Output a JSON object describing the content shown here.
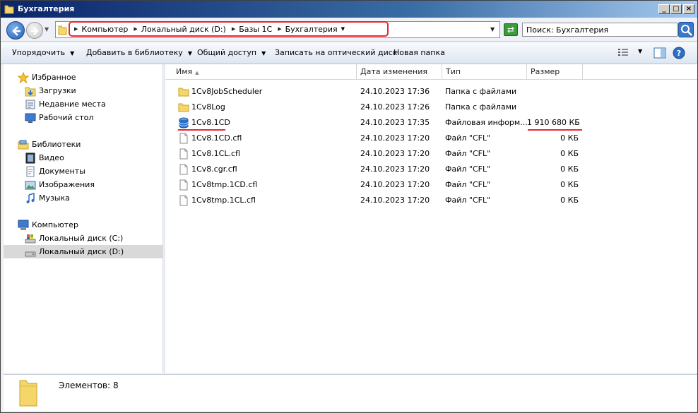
{
  "window": {
    "title": "Бухгалтерия",
    "controls": [
      "_",
      "□",
      "×"
    ]
  },
  "address": {
    "crumbs": [
      "Компьютер",
      "Локальный диск (D:)",
      "Базы 1С",
      "Бухгалтерия"
    ],
    "search_text": "Поиск: Бухгалтерия"
  },
  "toolbar": {
    "organize": "Упорядочить",
    "add_to_library": "Добавить в библиотеку",
    "share": "Общий доступ",
    "burn": "Записать на оптический диск",
    "new_folder": "Новая папка"
  },
  "nav": {
    "favorites": {
      "label": "Избранное",
      "items": [
        "Загрузки",
        "Недавние места",
        "Рабочий стол"
      ]
    },
    "libraries": {
      "label": "Библиотеки",
      "items": [
        "Видео",
        "Документы",
        "Изображения",
        "Музыка"
      ]
    },
    "computer": {
      "label": "Компьютер",
      "items": [
        "Локальный диск (C:)",
        "Локальный диск (D:)"
      ],
      "selected": "Локальный диск (D:)"
    }
  },
  "columns": {
    "name": "Имя",
    "modified": "Дата изменения",
    "type": "Тип",
    "size": "Размер"
  },
  "files": [
    {
      "name": "1Cv8JobScheduler",
      "modified": "24.10.2023 17:36",
      "type": "Папка с файлами",
      "size": "",
      "icon": "folder-icon"
    },
    {
      "name": "1Cv8Log",
      "modified": "24.10.2023 17:26",
      "type": "Папка с файлами",
      "size": "",
      "icon": "folder-icon"
    },
    {
      "name": "1Cv8.1CD",
      "modified": "24.10.2023 17:35",
      "type": "Файловая информ...",
      "size": "1 910 680 КБ",
      "icon": "database-icon",
      "highlighted": true
    },
    {
      "name": "1Cv8.1CD.cfl",
      "modified": "24.10.2023 17:20",
      "type": "Файл \"CFL\"",
      "size": "0 КБ",
      "icon": "file-icon"
    },
    {
      "name": "1Cv8.1CL.cfl",
      "modified": "24.10.2023 17:20",
      "type": "Файл \"CFL\"",
      "size": "0 КБ",
      "icon": "file-icon"
    },
    {
      "name": "1Cv8.cgr.cfl",
      "modified": "24.10.2023 17:20",
      "type": "Файл \"CFL\"",
      "size": "0 КБ",
      "icon": "file-icon"
    },
    {
      "name": "1Cv8tmp.1CD.cfl",
      "modified": "24.10.2023 17:20",
      "type": "Файл \"CFL\"",
      "size": "0 КБ",
      "icon": "file-icon"
    },
    {
      "name": "1Cv8tmp.1CL.cfl",
      "modified": "24.10.2023 17:20",
      "type": "Файл \"CFL\"",
      "size": "0 КБ",
      "icon": "file-icon"
    }
  ],
  "status": {
    "items_count": "Элементов: 8"
  },
  "colors": {
    "highlight": "#e8262e",
    "title_bar": "#0a246a",
    "selection": "#d9d9d9"
  }
}
